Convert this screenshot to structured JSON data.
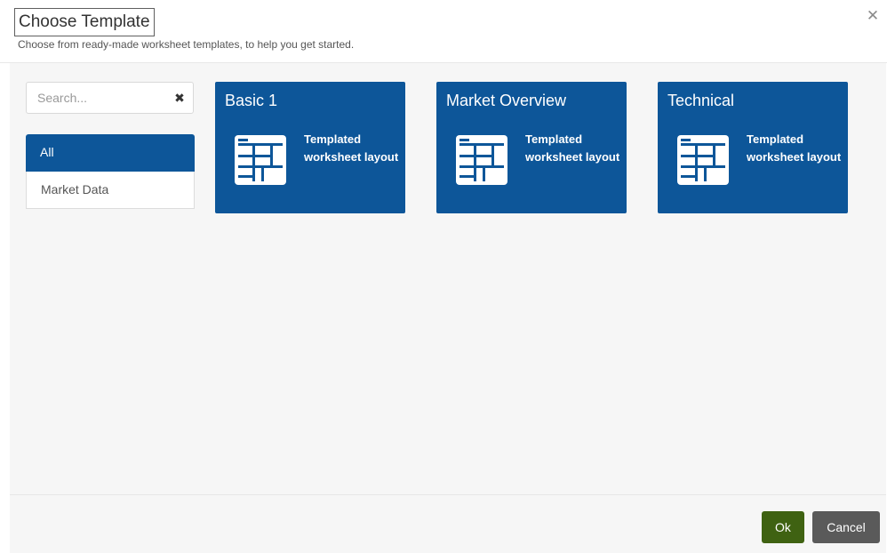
{
  "dialog": {
    "title": "Choose Template",
    "subtitle": "Choose from ready-made worksheet templates, to help you get started.",
    "close_icon": "close-icon"
  },
  "search": {
    "placeholder": "Search...",
    "value": "",
    "clear_icon": "clear-icon"
  },
  "categories": [
    {
      "label": "All",
      "active": true
    },
    {
      "label": "Market Data",
      "active": false
    }
  ],
  "templates": [
    {
      "name": "Basic 1",
      "description": "Templated worksheet layout",
      "icon": "worksheet-layout-icon"
    },
    {
      "name": "Market Overview",
      "description": "Templated worksheet layout",
      "icon": "worksheet-layout-icon"
    },
    {
      "name": "Technical",
      "description": "Templated worksheet layout",
      "icon": "worksheet-layout-icon"
    }
  ],
  "footer": {
    "ok_label": "Ok",
    "cancel_label": "Cancel"
  },
  "colors": {
    "tile_bg": "#0d5699",
    "active_category_bg": "#0d5699",
    "ok_button": "#3f6212",
    "cancel_button": "#5a5a5a"
  }
}
